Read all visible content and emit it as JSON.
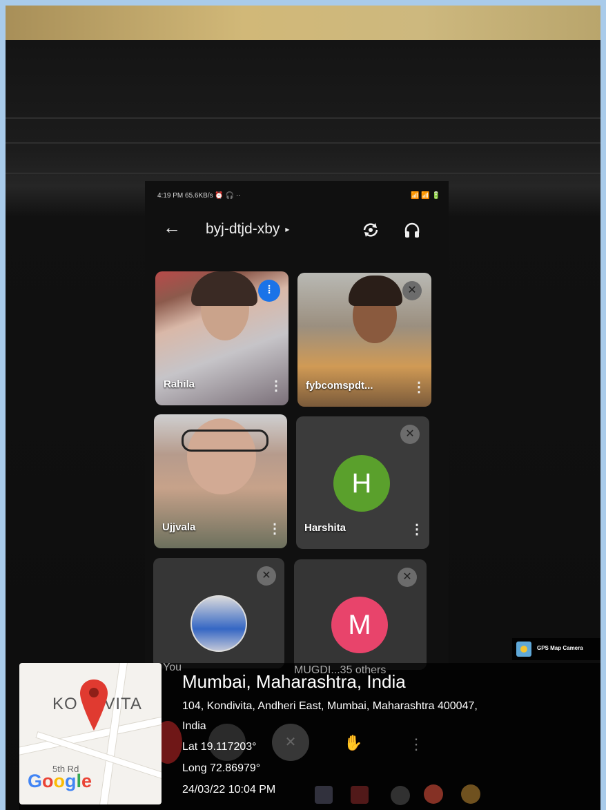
{
  "status_bar": {
    "left": "4:19 PM 65.6KB/s ⏰ 🎧 ··",
    "right": "📶 📶 🔋"
  },
  "meeting": {
    "code": "byj-dtjd-xby",
    "caret": "▸"
  },
  "participants": [
    {
      "name": "Rahila",
      "state": "speaking"
    },
    {
      "name": "fybcomspdt...",
      "state": "muted"
    },
    {
      "name": "Ujjvala",
      "state": "video"
    },
    {
      "name": "Harshita",
      "initial": "H",
      "color": "#5aa02c",
      "state": "muted"
    },
    {
      "name": "You",
      "state": "muted"
    },
    {
      "name": "MUGDI...35 others",
      "initial": "M",
      "color": "#e8446b",
      "state": "muted"
    }
  ],
  "watermark": {
    "badge": "GPS Map Camera",
    "title": "Mumbai, Maharashtra, India",
    "address_line1": "104, Kondivita, Andheri East, Mumbai, Maharashtra 400047,",
    "address_line2": "India",
    "lat": "Lat 19.117203°",
    "long": "Long 72.86979°",
    "datetime": "24/03/22 10:04 PM"
  },
  "map": {
    "area_label_left": "KO",
    "area_label_right": "IVITA",
    "road_label": "5th Rd",
    "logo": "Google"
  }
}
